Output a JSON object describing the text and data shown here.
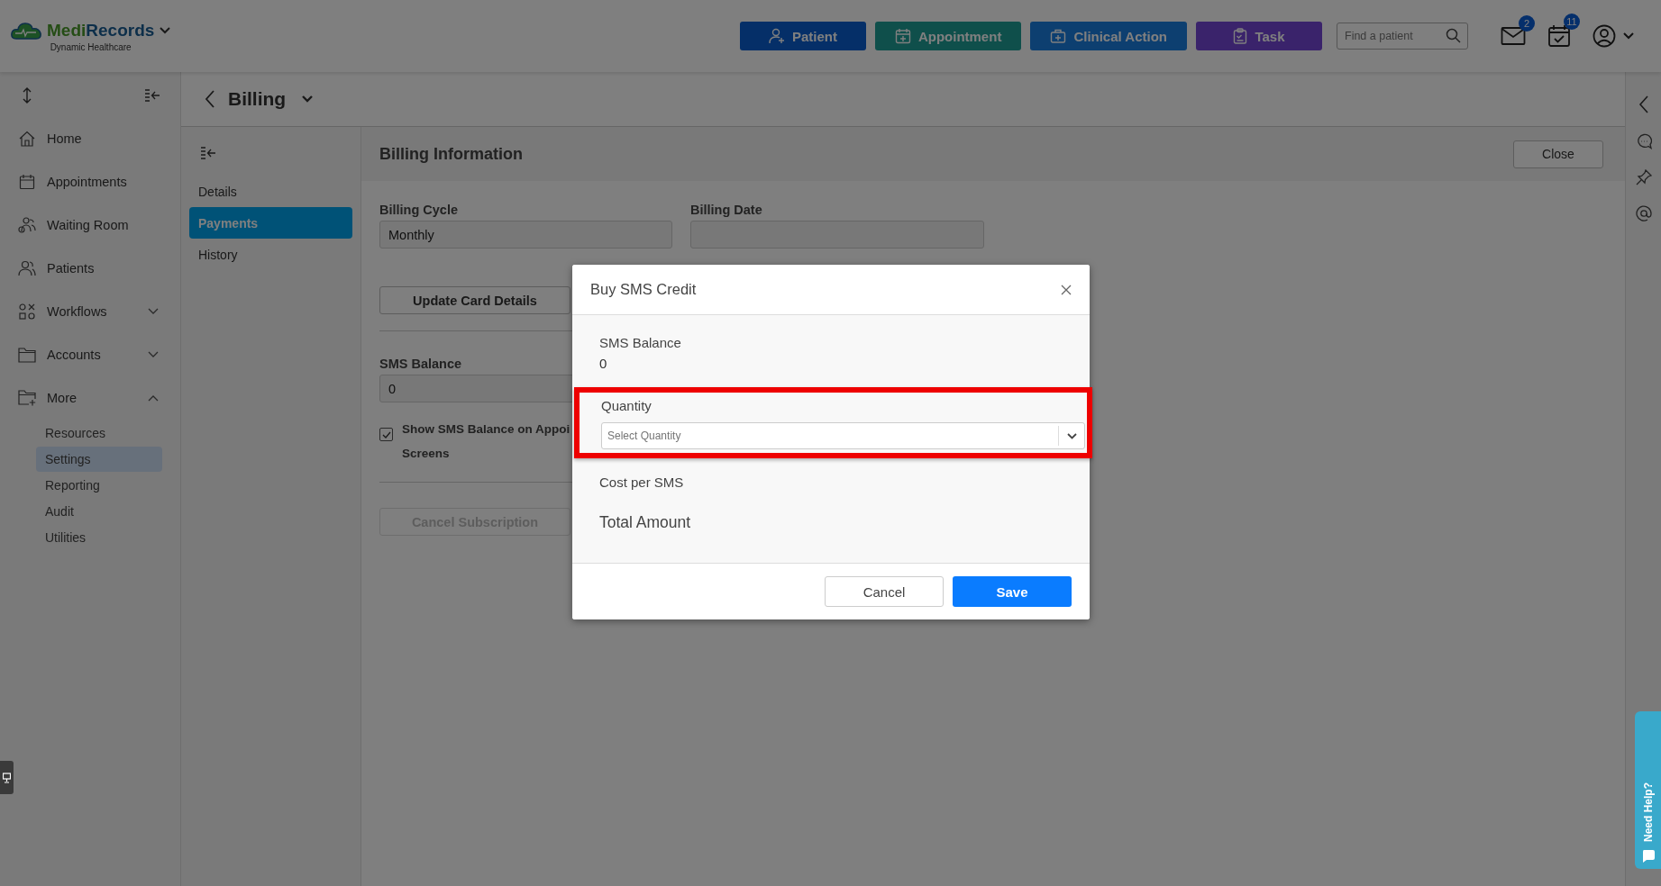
{
  "header": {
    "brand": {
      "first": "Medi",
      "second": "Records"
    },
    "subtitle": "Dynamic Healthcare",
    "actions": [
      {
        "label": "Patient",
        "kind": "patient"
      },
      {
        "label": "Appointment",
        "kind": "appointment"
      },
      {
        "label": "Clinical Action",
        "kind": "clinical"
      },
      {
        "label": "Task",
        "kind": "task"
      }
    ],
    "search": {
      "placeholder": "Find a patient"
    },
    "notifications": [
      {
        "kind": "mail",
        "count": "2"
      },
      {
        "kind": "calendar",
        "count": "11"
      }
    ]
  },
  "sidebar": {
    "items": [
      {
        "label": "Home",
        "kind": "home"
      },
      {
        "label": "Appointments",
        "kind": "calendar"
      },
      {
        "label": "Waiting Room",
        "kind": "waiting"
      },
      {
        "label": "Patients",
        "kind": "patients"
      },
      {
        "label": "Workflows",
        "kind": "workflows",
        "expanded": false
      },
      {
        "label": "Accounts",
        "kind": "folder",
        "expanded": false
      },
      {
        "label": "More",
        "kind": "folder-plus",
        "expanded": true,
        "children": [
          {
            "label": "Resources",
            "selected": false
          },
          {
            "label": "Settings",
            "selected": true
          },
          {
            "label": "Reporting",
            "selected": false
          },
          {
            "label": "Audit",
            "selected": false
          },
          {
            "label": "Utilities",
            "selected": false
          }
        ]
      }
    ]
  },
  "page": {
    "title": "Billing",
    "subnav": [
      {
        "label": "Details",
        "selected": false
      },
      {
        "label": "Payments",
        "selected": true
      },
      {
        "label": "History",
        "selected": false
      }
    ],
    "section_title": "Billing Information",
    "close": "Close",
    "billing_cycle": {
      "label": "Billing Cycle",
      "value": "Monthly"
    },
    "billing_date": {
      "label": "Billing Date"
    },
    "update_card": "Update Card Details",
    "sms_balance": {
      "label": "SMS Balance",
      "value": "0"
    },
    "show_balance": {
      "lines": [
        "Show SMS Balance on Appoi",
        "Screens"
      ],
      "checked": true
    },
    "cancel_subscription": {
      "label": "Cancel Subscription",
      "disabled": true
    }
  },
  "modal": {
    "title": "Buy SMS Credit",
    "sms_balance": {
      "label": "SMS Balance",
      "value": "0"
    },
    "quantity": {
      "label": "Quantity",
      "placeholder": "Select Quantity",
      "highlighted": true
    },
    "cost_label": "Cost per SMS",
    "total_label": "Total Amount",
    "buttons": [
      {
        "label": "Cancel",
        "kind": "secondary"
      },
      {
        "label": "Save",
        "kind": "primary"
      }
    ]
  },
  "help_tab": {
    "label": "Need Help?"
  }
}
